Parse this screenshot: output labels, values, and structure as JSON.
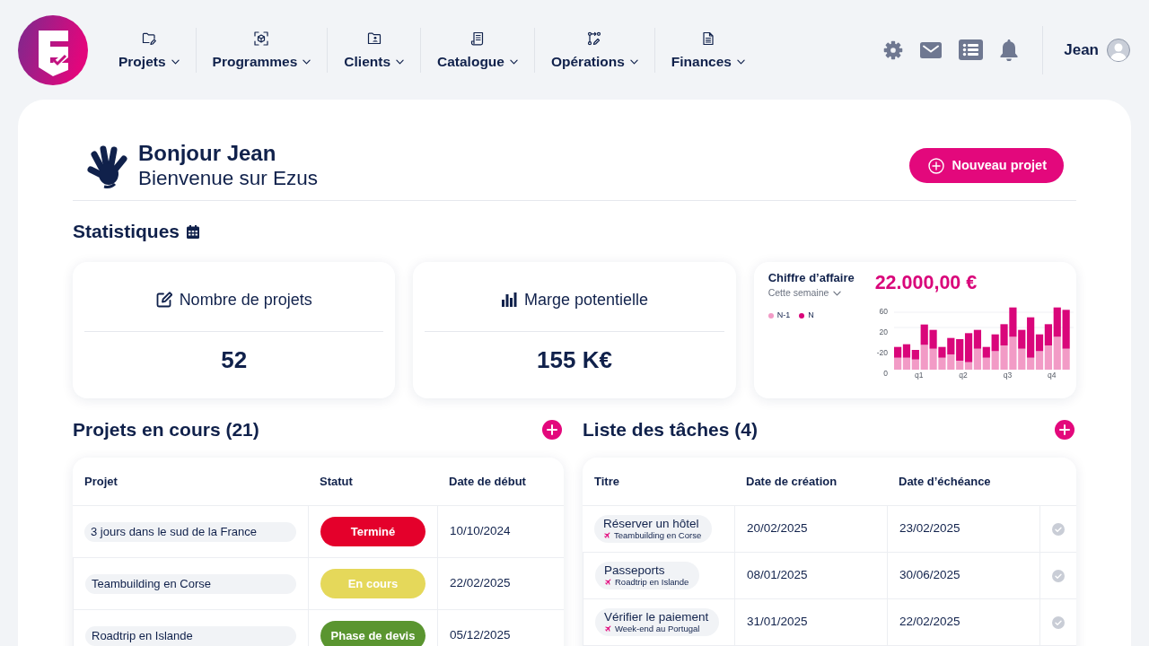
{
  "nav": {
    "items": [
      {
        "label": "Projets"
      },
      {
        "label": "Programmes"
      },
      {
        "label": "Clients"
      },
      {
        "label": "Catalogue"
      },
      {
        "label": "Opérations"
      },
      {
        "label": "Finances"
      }
    ]
  },
  "user": {
    "name": "Jean"
  },
  "greeting": {
    "title": "Bonjour Jean",
    "subtitle": "Bienvenue sur Ezus",
    "button": "Nouveau projet"
  },
  "stats": {
    "title": "Statistiques",
    "cards": [
      {
        "kind": "metric",
        "label": "Nombre de projets",
        "value": "52"
      },
      {
        "kind": "metric",
        "label": "Marge potentielle",
        "value": "155 K€"
      },
      {
        "kind": "chart",
        "title": "Chiffre d’affaire",
        "period": "Cette semaine",
        "amount": "22.000,00 €",
        "legend": [
          {
            "label": "N-1",
            "color": "#f29bc6"
          },
          {
            "label": "N",
            "color": "#d9067a"
          }
        ],
        "y_labels": [
          "60",
          "20",
          "-20",
          "0"
        ],
        "x_labels": [
          "q1",
          "q2",
          "q3",
          "q4"
        ]
      }
    ]
  },
  "projects": {
    "title": "Projets en cours (21)",
    "columns": [
      "Projet",
      "Statut",
      "Date de début"
    ],
    "rows": [
      {
        "name": "3 jours dans le sud de la France",
        "status": "Terminé",
        "color": "#e4002b",
        "start": "10/10/2024"
      },
      {
        "name": "Teambuilding en Corse",
        "status": "En cours",
        "color": "#e5d85a",
        "start": "22/02/2025"
      },
      {
        "name": "Roadtrip en Islande",
        "status": "Phase de devis",
        "color": "#5a9530",
        "start": "05/12/2025"
      }
    ]
  },
  "tasks": {
    "title": "Liste des tâches (4)",
    "columns": [
      "Titre",
      "Date de création",
      "Date d’échéance"
    ],
    "rows": [
      {
        "title": "Réserver un hôtel",
        "project": "Teambuilding en Corse",
        "created": "20/02/2025",
        "due": "23/02/2025",
        "done": false
      },
      {
        "title": "Passeports",
        "project": "Roadtrip en Islande",
        "created": "08/01/2025",
        "due": "30/06/2025",
        "done": false
      },
      {
        "title": "Vérifier le paiement",
        "project": "Week-end au Portugal",
        "created": "31/01/2025",
        "due": "22/02/2025",
        "done": false
      }
    ]
  }
}
